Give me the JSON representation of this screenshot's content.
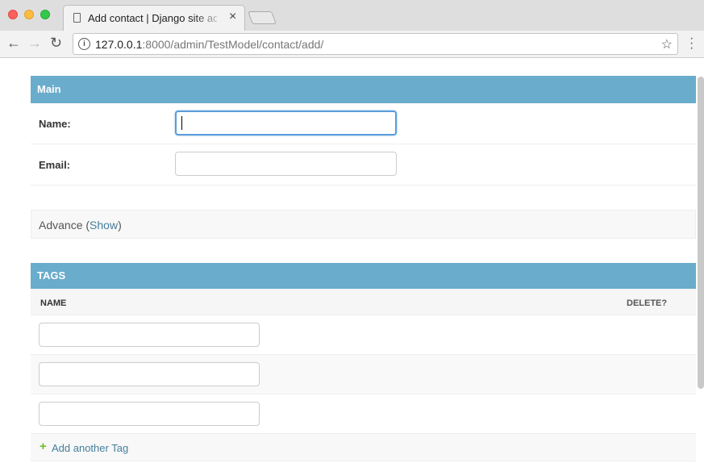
{
  "browser": {
    "tab_title": "Add contact | Django site admin",
    "tab_close": "×",
    "url_host": "127.0.0.1",
    "url_rest": ":8000/admin/TestModel/contact/add/",
    "info_icon": "i",
    "star_icon": "☆",
    "menu_icon": "⋮",
    "back_icon": "←",
    "forward_icon": "→",
    "reload_icon": "↻"
  },
  "form": {
    "main_header": "Main",
    "name_label": "Name:",
    "name_value": "",
    "email_label": "Email:",
    "email_value": "",
    "advance_label": "Advance (",
    "advance_show": "Show",
    "advance_close": ")"
  },
  "tags": {
    "header": "TAGS",
    "col_name": "NAME",
    "col_delete": "DELETE?",
    "rows": [
      "",
      "",
      ""
    ],
    "add_plus": "+",
    "add_label": "Add another Tag"
  },
  "colors": {
    "module_header": "#6aaccb",
    "link": "#447e9b",
    "add_plus": "#70bf2b"
  }
}
